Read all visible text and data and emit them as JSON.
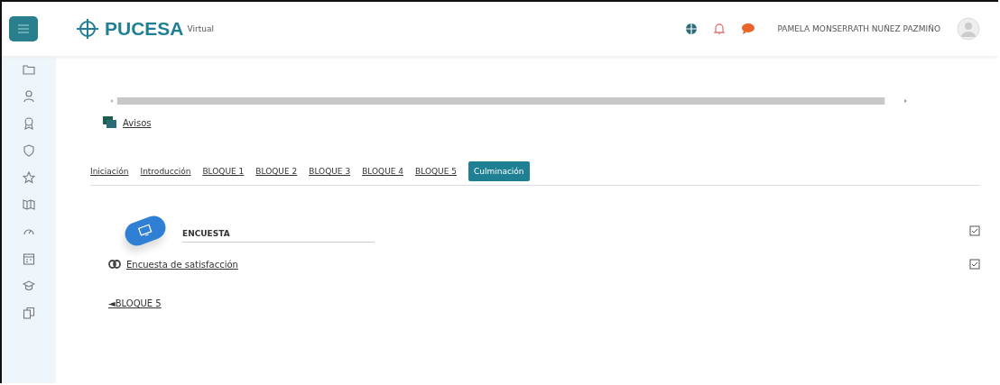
{
  "header": {
    "brand": "PUCESA",
    "brand_suffix": "Virtual",
    "user_name": "PAMELA MONSERRATH NUÑEZ PAZMIÑO"
  },
  "sidebar": {
    "items": [
      {
        "kind": "folder"
      },
      {
        "kind": "person"
      },
      {
        "kind": "badge"
      },
      {
        "kind": "shield"
      },
      {
        "kind": "star"
      },
      {
        "kind": "map"
      },
      {
        "kind": "gauge"
      },
      {
        "kind": "calendar"
      },
      {
        "kind": "cap"
      },
      {
        "kind": "copy"
      }
    ]
  },
  "forum_link": "Avisos",
  "tabs": [
    {
      "label": "Iniciación",
      "selected": false
    },
    {
      "label": "Introducción",
      "selected": false
    },
    {
      "label": "BLOQUE 1",
      "selected": false
    },
    {
      "label": "BLOQUE 2",
      "selected": false
    },
    {
      "label": "BLOQUE 3",
      "selected": false
    },
    {
      "label": "BLOQUE 4",
      "selected": false
    },
    {
      "label": "BLOQUE 5",
      "selected": false
    },
    {
      "label": "Culminación",
      "selected": true
    }
  ],
  "section": {
    "title": "ENCUESTA",
    "activities": [
      {
        "label": "Encuesta de satisfacción"
      }
    ]
  },
  "prev_link": "◄BLOQUE 5"
}
